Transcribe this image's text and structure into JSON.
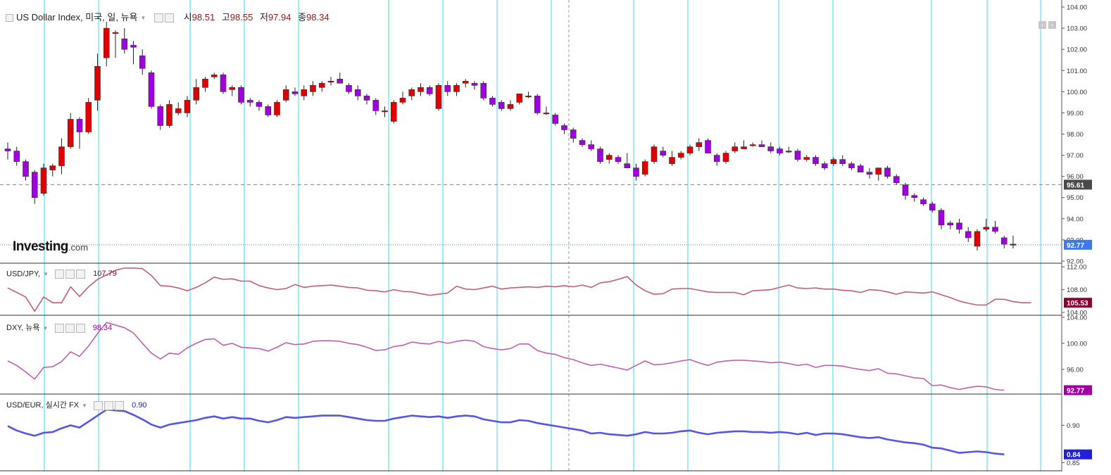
{
  "chart_data": [
    {
      "type": "candlestick",
      "title": "US Dollar Index, 미국, 일, 뉴욕",
      "ohlc": {
        "open_label": "시",
        "open": "98.51",
        "high_label": "고",
        "high": "98.55",
        "low_label": "저",
        "low": "97.94",
        "close_label": "종",
        "close": "98.34"
      },
      "ylim": [
        91.9,
        104.2
      ],
      "yticks": [
        "104.00",
        "103.00",
        "102.00",
        "101.00",
        "100.00",
        "99.00",
        "98.00",
        "97.00",
        "96.00",
        "95.00",
        "94.00",
        "93.00",
        "92.00"
      ],
      "reference_line_label": "95.61",
      "last_price_label": "92.77",
      "candles": [
        [
          97.3,
          97.6,
          96.8,
          97.2
        ],
        [
          97.2,
          97.4,
          96.5,
          96.7
        ],
        [
          96.7,
          96.8,
          95.8,
          96.0
        ],
        [
          96.2,
          96.3,
          94.7,
          95.0
        ],
        [
          95.2,
          96.6,
          95.1,
          96.4
        ],
        [
          96.3,
          96.6,
          96.0,
          96.5
        ],
        [
          96.5,
          97.8,
          96.1,
          97.4
        ],
        [
          97.4,
          99.0,
          97.3,
          98.7
        ],
        [
          98.7,
          98.8,
          97.3,
          98.1
        ],
        [
          98.1,
          99.7,
          98.0,
          99.5
        ],
        [
          99.6,
          101.8,
          99.1,
          101.2
        ],
        [
          101.6,
          103.3,
          101.2,
          103.0
        ],
        [
          102.8,
          102.9,
          101.6,
          102.8
        ],
        [
          102.5,
          103.0,
          101.8,
          102.0
        ],
        [
          102.2,
          102.4,
          101.3,
          102.1
        ],
        [
          101.7,
          102.0,
          100.8,
          101.1
        ],
        [
          100.9,
          101.0,
          99.2,
          99.3
        ],
        [
          99.3,
          99.4,
          98.2,
          98.4
        ],
        [
          98.4,
          99.6,
          98.3,
          99.4
        ],
        [
          99.0,
          99.5,
          98.9,
          99.2
        ],
        [
          99.0,
          99.8,
          98.8,
          99.6
        ],
        [
          99.6,
          100.6,
          99.4,
          100.2
        ],
        [
          100.2,
          100.7,
          100.0,
          100.6
        ],
        [
          100.7,
          100.9,
          100.6,
          100.8
        ],
        [
          100.8,
          100.9,
          99.9,
          100.0
        ],
        [
          100.1,
          100.3,
          99.8,
          100.2
        ],
        [
          100.2,
          100.3,
          99.4,
          99.5
        ],
        [
          99.6,
          99.7,
          99.3,
          99.5
        ],
        [
          99.5,
          99.6,
          99.1,
          99.3
        ],
        [
          99.3,
          99.4,
          98.8,
          98.9
        ],
        [
          98.9,
          99.6,
          98.8,
          99.5
        ],
        [
          99.6,
          100.3,
          99.5,
          100.1
        ],
        [
          100.0,
          100.2,
          99.8,
          99.9
        ],
        [
          99.8,
          100.3,
          99.6,
          100.1
        ],
        [
          100.0,
          100.5,
          99.8,
          100.3
        ],
        [
          100.2,
          100.5,
          100.0,
          100.4
        ],
        [
          100.5,
          100.7,
          100.3,
          100.5
        ],
        [
          100.6,
          100.9,
          100.4,
          100.4
        ],
        [
          100.3,
          100.4,
          99.9,
          100.0
        ],
        [
          100.1,
          100.3,
          99.6,
          99.8
        ],
        [
          99.8,
          99.9,
          99.4,
          99.6
        ],
        [
          99.6,
          99.7,
          98.9,
          99.1
        ],
        [
          99.1,
          99.3,
          98.8,
          99.1
        ],
        [
          98.6,
          99.6,
          98.5,
          99.5
        ],
        [
          99.5,
          100.0,
          99.4,
          99.7
        ],
        [
          99.8,
          100.2,
          99.6,
          100.1
        ],
        [
          100.0,
          100.4,
          99.8,
          100.2
        ],
        [
          100.2,
          100.3,
          99.8,
          99.9
        ],
        [
          99.2,
          100.4,
          99.1,
          100.3
        ],
        [
          100.3,
          100.5,
          99.8,
          100.0
        ],
        [
          100.0,
          100.4,
          99.8,
          100.3
        ],
        [
          100.4,
          100.6,
          100.2,
          100.5
        ],
        [
          100.4,
          100.5,
          100.1,
          100.3
        ],
        [
          100.4,
          100.5,
          99.6,
          99.7
        ],
        [
          99.7,
          99.8,
          99.3,
          99.4
        ],
        [
          99.5,
          99.6,
          99.1,
          99.2
        ],
        [
          99.2,
          99.6,
          99.1,
          99.4
        ],
        [
          99.5,
          99.9,
          99.4,
          99.9
        ],
        [
          99.8,
          100.0,
          99.7,
          99.8
        ],
        [
          99.8,
          99.9,
          98.9,
          99.0
        ],
        [
          99.0,
          99.3,
          98.9,
          99.0
        ],
        [
          98.9,
          99.0,
          98.4,
          98.5
        ],
        [
          98.4,
          98.5,
          98.0,
          98.2
        ],
        [
          98.2,
          98.3,
          97.6,
          97.8
        ],
        [
          97.7,
          97.8,
          97.4,
          97.5
        ],
        [
          97.5,
          97.7,
          97.2,
          97.3
        ],
        [
          97.3,
          97.4,
          96.6,
          96.7
        ],
        [
          96.8,
          97.1,
          96.6,
          97.0
        ],
        [
          96.9,
          97.0,
          96.6,
          96.7
        ],
        [
          96.6,
          97.1,
          96.4,
          96.4
        ],
        [
          96.4,
          96.6,
          95.8,
          96.0
        ],
        [
          96.1,
          96.8,
          96.0,
          96.7
        ],
        [
          96.7,
          97.5,
          96.6,
          97.4
        ],
        [
          97.2,
          97.4,
          96.9,
          97.0
        ],
        [
          96.6,
          97.2,
          96.5,
          96.9
        ],
        [
          96.9,
          97.2,
          96.8,
          97.1
        ],
        [
          97.1,
          97.5,
          97.0,
          97.4
        ],
        [
          97.4,
          97.8,
          97.2,
          97.6
        ],
        [
          97.7,
          97.8,
          97.1,
          97.1
        ],
        [
          97.0,
          97.1,
          96.5,
          96.7
        ],
        [
          96.7,
          97.2,
          96.6,
          97.1
        ],
        [
          97.2,
          97.6,
          97.1,
          97.4
        ],
        [
          97.3,
          97.7,
          97.3,
          97.4
        ],
        [
          97.5,
          97.6,
          97.4,
          97.5
        ],
        [
          97.5,
          97.7,
          97.4,
          97.4
        ],
        [
          97.4,
          97.6,
          97.1,
          97.2
        ],
        [
          97.3,
          97.4,
          97.0,
          97.1
        ],
        [
          97.2,
          97.4,
          97.1,
          97.2
        ],
        [
          97.2,
          97.3,
          96.7,
          96.8
        ],
        [
          96.8,
          97.0,
          96.7,
          96.9
        ],
        [
          96.9,
          97.0,
          96.5,
          96.6
        ],
        [
          96.6,
          96.7,
          96.3,
          96.4
        ],
        [
          96.6,
          96.9,
          96.5,
          96.8
        ],
        [
          96.8,
          97.0,
          96.5,
          96.6
        ],
        [
          96.6,
          96.7,
          96.3,
          96.4
        ],
        [
          96.5,
          96.6,
          96.2,
          96.2
        ],
        [
          96.2,
          96.4,
          95.9,
          96.1
        ],
        [
          96.1,
          96.4,
          95.8,
          96.4
        ],
        [
          96.4,
          96.5,
          95.9,
          96.0
        ],
        [
          96.0,
          96.1,
          95.6,
          95.7
        ],
        [
          95.6,
          95.7,
          94.9,
          95.1
        ],
        [
          95.1,
          95.2,
          94.8,
          95.0
        ],
        [
          94.9,
          95.0,
          94.6,
          94.7
        ],
        [
          94.7,
          94.8,
          94.3,
          94.4
        ],
        [
          94.4,
          94.5,
          93.5,
          93.7
        ],
        [
          93.8,
          93.9,
          93.5,
          93.7
        ],
        [
          93.8,
          94.0,
          93.3,
          93.5
        ],
        [
          93.4,
          93.6,
          92.9,
          93.1
        ],
        [
          92.7,
          93.5,
          92.5,
          93.4
        ],
        [
          93.5,
          94.0,
          93.4,
          93.6
        ],
        [
          93.6,
          93.9,
          93.3,
          93.4
        ],
        [
          93.1,
          93.2,
          92.6,
          92.8
        ],
        [
          92.8,
          93.2,
          92.6,
          92.8
        ]
      ]
    },
    {
      "type": "line",
      "title": "USD/JPY,",
      "value_label": "107.79",
      "last_price_label": "105.53",
      "ylim": [
        103.5,
        112.4
      ],
      "yticks": [
        "112.00",
        "108.00",
        "104.00"
      ],
      "y": [
        108.3,
        107.5,
        106.7,
        104.2,
        106.7,
        105.7,
        105.7,
        108.5,
        106.8,
        108.5,
        109.8,
        110.6,
        111.4,
        111.8,
        111.8,
        111.7,
        110.5,
        108.7,
        108.6,
        108.3,
        107.8,
        108.4,
        109.2,
        110.2,
        109.8,
        109.9,
        109.5,
        109.5,
        108.7,
        108.3,
        108.0,
        108.2,
        108.9,
        108.4,
        108.6,
        108.7,
        108.8,
        108.6,
        108.4,
        108.3,
        107.9,
        107.8,
        107.6,
        108.0,
        107.7,
        107.6,
        107.3,
        107.0,
        107.2,
        107.4,
        108.6,
        108.1,
        108.0,
        108.3,
        108.6,
        108.1,
        108.3,
        108.4,
        108.5,
        108.4,
        108.6,
        108.5,
        108.7,
        108.5,
        108.8,
        108.4,
        109.2,
        109.4,
        109.8,
        110.3,
        108.8,
        107.8,
        107.2,
        107.3,
        108.1,
        108.2,
        108.2,
        107.9,
        107.6,
        107.5,
        107.5,
        107.5,
        107.1,
        107.8,
        107.9,
        108.0,
        108.4,
        108.8,
        108.3,
        108.2,
        108.3,
        108.1,
        108.1,
        107.9,
        107.8,
        107.5,
        108.0,
        107.9,
        107.6,
        107.2,
        107.6,
        107.5,
        107.4,
        107.6,
        107.1,
        106.6,
        106.0,
        105.6,
        105.3,
        105.3,
        106.3,
        106.3,
        105.9,
        105.7,
        105.7
      ]
    },
    {
      "type": "line",
      "title": "DXY, 뉴욕",
      "value_label": "98.34",
      "last_price_label": "92.77",
      "ylim": [
        92.2,
        104.1
      ],
      "yticks": [
        "104.00",
        "100.00",
        "96.00"
      ],
      "y": [
        97.3,
        96.6,
        95.6,
        94.5,
        96.3,
        96.4,
        97.2,
        98.7,
        98.0,
        99.6,
        101.5,
        103.2,
        102.8,
        102.4,
        101.6,
        100.0,
        98.5,
        97.6,
        98.5,
        98.3,
        99.3,
        100.0,
        100.6,
        100.7,
        99.7,
        100.0,
        99.4,
        99.3,
        99.2,
        98.8,
        99.4,
        100.1,
        99.8,
        99.9,
        100.3,
        100.4,
        100.4,
        100.3,
        100.0,
        99.8,
        99.4,
        98.9,
        99.0,
        99.5,
        99.7,
        100.2,
        100.0,
        99.9,
        100.3,
        100.0,
        100.3,
        100.5,
        100.3,
        99.5,
        99.2,
        99.0,
        99.2,
        99.9,
        99.9,
        98.9,
        98.5,
        98.3,
        97.8,
        97.5,
        97.0,
        96.6,
        96.8,
        96.5,
        96.2,
        95.9,
        96.6,
        97.3,
        96.7,
        96.8,
        97.0,
        97.3,
        97.5,
        97.0,
        96.6,
        97.1,
        97.3,
        97.4,
        97.4,
        97.3,
        97.2,
        97.0,
        97.1,
        96.9,
        96.6,
        96.8,
        96.3,
        96.6,
        96.6,
        96.5,
        96.2,
        96.0,
        95.8,
        96.1,
        95.4,
        95.3,
        95.0,
        94.7,
        94.6,
        93.5,
        93.6,
        93.2,
        92.9,
        93.2,
        93.4,
        93.3,
        92.9,
        92.8
      ]
    },
    {
      "type": "line",
      "title": "USD/EUR, 실시간 FX",
      "value_label": "0.90",
      "last_price_label": "0.84",
      "ylim": [
        0.839,
        0.94
      ],
      "yticks": [
        "0.90",
        "0.85"
      ],
      "y": [
        0.899,
        0.893,
        0.889,
        0.886,
        0.89,
        0.891,
        0.896,
        0.9,
        0.897,
        0.905,
        0.913,
        0.921,
        0.92,
        0.919,
        0.914,
        0.908,
        0.901,
        0.897,
        0.901,
        0.903,
        0.905,
        0.907,
        0.91,
        0.912,
        0.909,
        0.911,
        0.909,
        0.909,
        0.906,
        0.904,
        0.907,
        0.911,
        0.91,
        0.911,
        0.912,
        0.913,
        0.913,
        0.913,
        0.911,
        0.909,
        0.907,
        0.906,
        0.906,
        0.909,
        0.911,
        0.913,
        0.912,
        0.911,
        0.912,
        0.91,
        0.912,
        0.913,
        0.912,
        0.908,
        0.906,
        0.904,
        0.904,
        0.907,
        0.906,
        0.903,
        0.901,
        0.899,
        0.897,
        0.895,
        0.893,
        0.889,
        0.89,
        0.888,
        0.887,
        0.886,
        0.888,
        0.891,
        0.889,
        0.889,
        0.89,
        0.892,
        0.893,
        0.89,
        0.888,
        0.89,
        0.891,
        0.892,
        0.892,
        0.891,
        0.891,
        0.89,
        0.891,
        0.89,
        0.888,
        0.89,
        0.887,
        0.889,
        0.889,
        0.888,
        0.886,
        0.884,
        0.883,
        0.884,
        0.881,
        0.879,
        0.877,
        0.876,
        0.874,
        0.87,
        0.869,
        0.866,
        0.863,
        0.864,
        0.865,
        0.864,
        0.862,
        0.861
      ]
    }
  ],
  "toolbar_icons": [
    "settings-icon",
    "gear-icon",
    "close-icon"
  ],
  "window_controls": [
    "scroll-left-icon",
    "scroll-right-icon"
  ],
  "logo": {
    "text": "Investing",
    "suffix": ".com"
  },
  "colors": {
    "bull": "#e00000",
    "bear": "#a000e0",
    "jpy_line": "#c06078",
    "dxy_line": "#c060b0",
    "eur_line": "#5555ee",
    "vertical_guides": "#33e0f0",
    "label_reference": "#4a4a4a",
    "label_main": "#3f78f0",
    "label_jpy": "#8b0032",
    "label_dxy": "#a000a0",
    "label_eur": "#2020dd"
  }
}
